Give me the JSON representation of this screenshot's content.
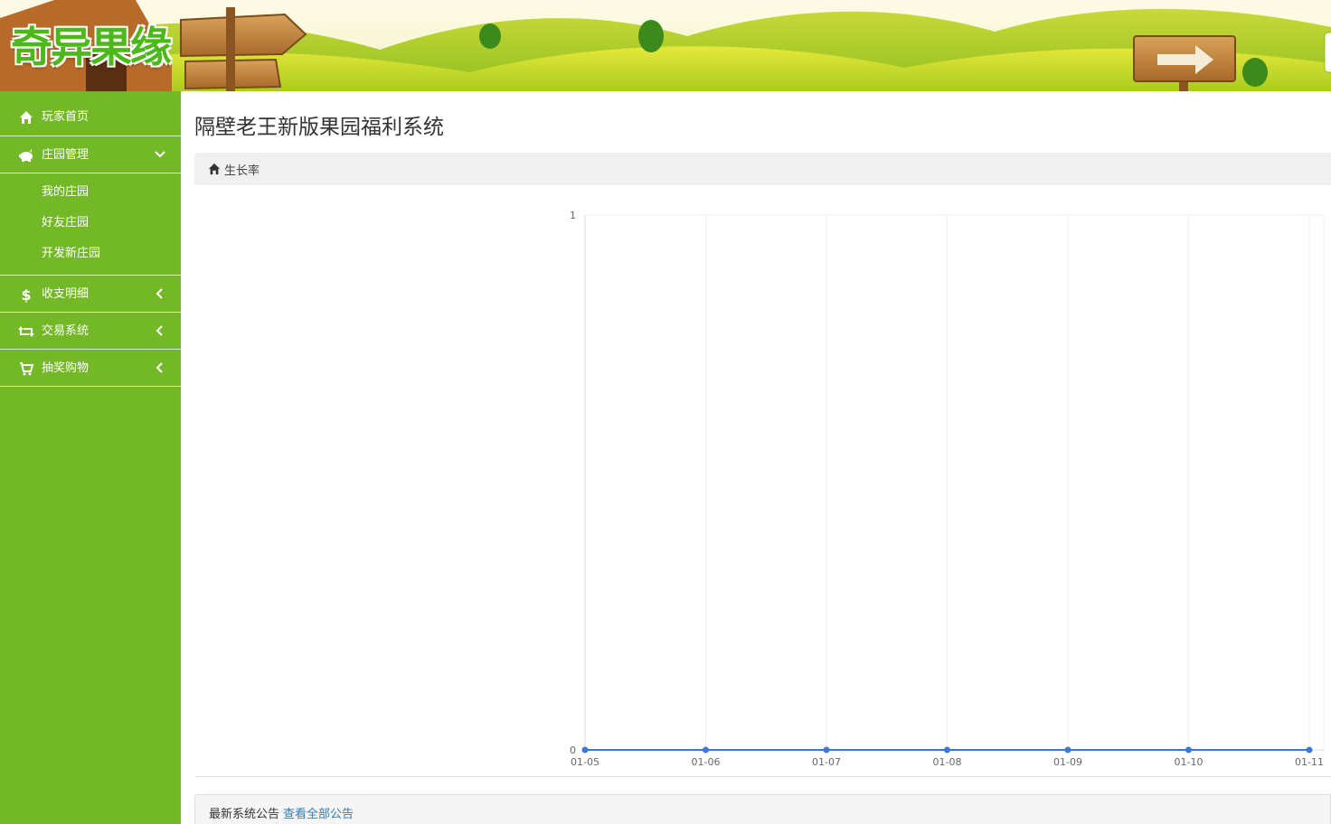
{
  "header": {
    "logo_text": "奇异果缘"
  },
  "sidebar": {
    "items": [
      {
        "label": "玩家首页",
        "icon": "home-icon"
      },
      {
        "label": "庄园管理",
        "icon": "piggy-bank-icon",
        "expanded": true,
        "children": [
          {
            "label": "我的庄园"
          },
          {
            "label": "好友庄园"
          },
          {
            "label": "开发新庄园"
          }
        ]
      },
      {
        "label": "收支明细",
        "icon": "dollar-icon",
        "expanded": false
      },
      {
        "label": "交易系统",
        "icon": "retweet-icon",
        "expanded": false
      },
      {
        "label": "抽奖购物",
        "icon": "cart-icon",
        "expanded": false
      }
    ]
  },
  "main": {
    "page_title": "隔壁老王新版果园福利系统",
    "breadcrumb": "生长率",
    "notice": {
      "text": "最新系统公告",
      "link": "查看全部公告"
    }
  },
  "colors": {
    "sidebar_bg": "#73b826",
    "line": "#3c78d8",
    "grid": "#eeeeee",
    "link": "#337ab7"
  },
  "chart_data": {
    "type": "line",
    "title": "",
    "xlabel": "",
    "ylabel": "",
    "categories": [
      "01-05",
      "01-06",
      "01-07",
      "01-08",
      "01-09",
      "01-10",
      "01-11"
    ],
    "series": [
      {
        "values": [
          0,
          0,
          0,
          0,
          0,
          0,
          0
        ]
      }
    ],
    "ylim": [
      0,
      1
    ],
    "yticks": [
      "0",
      "1"
    ],
    "grid": true,
    "legend": "none"
  }
}
